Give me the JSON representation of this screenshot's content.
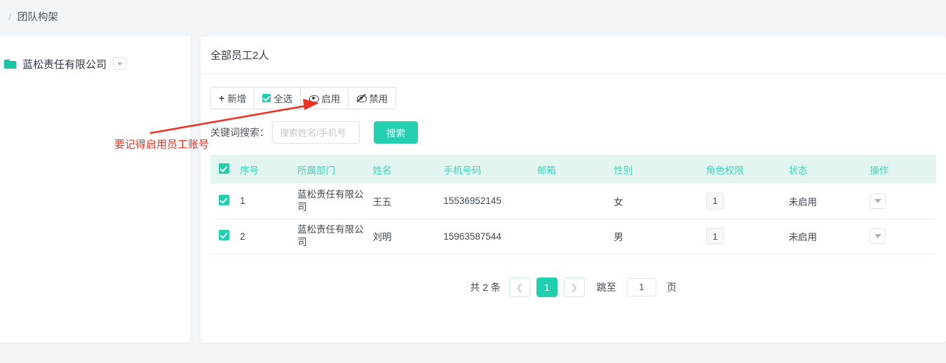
{
  "breadcrumb": {
    "separator": "/",
    "current": "团队构架"
  },
  "sidebar": {
    "folder_icon": "folder-icon",
    "org_name": "蓝松责任有限公司",
    "dropdown_icon": "chevron-down-icon"
  },
  "main": {
    "title": "全部员工2人",
    "toolbar": {
      "add_label": "新增",
      "add_icon": "plus-icon",
      "select_all_label": "全选",
      "select_all_icon": "checkbox-checked-icon",
      "enable_label": "启用",
      "enable_icon": "eye-icon",
      "disable_label": "禁用",
      "disable_icon": "eye-off-icon"
    },
    "search": {
      "label": "关键词搜索：",
      "placeholder": "搜索姓名/手机号",
      "value": "",
      "button_label": "搜索"
    },
    "table": {
      "headers": [
        "",
        "序号",
        "所属部门",
        "姓名",
        "手机号码",
        "邮箱",
        "性别",
        "角色权限",
        "状态",
        "操作"
      ],
      "header_checkbox_checked": true,
      "rows": [
        {
          "checked": true,
          "index": "1",
          "dept": "蓝松责任有限公司",
          "name": "王五",
          "phone": "15536952145",
          "email": "",
          "gender": "女",
          "role": "1",
          "status": "未启用",
          "op_icon": "chevron-down-icon"
        },
        {
          "checked": true,
          "index": "2",
          "dept": "蓝松责任有限公司",
          "name": "刘明",
          "phone": "15963587544",
          "email": "",
          "gender": "男",
          "role": "1",
          "status": "未启用",
          "op_icon": "chevron-down-icon"
        }
      ]
    },
    "pagination": {
      "total_text": "共 2 条",
      "prev_icon": "chevron-left-icon",
      "current_page": "1",
      "next_icon": "chevron-right-icon",
      "jump_label": "跳至",
      "jump_value": "1",
      "page_unit": "页"
    }
  },
  "annotation": {
    "text": "要记得启用员工账号",
    "color": "#ef3124"
  },
  "colors": {
    "accent": "#20cfae",
    "header_bg": "#e2f5f1",
    "header_text": "#3fd5bb",
    "page_bg": "#f2f5f7"
  }
}
